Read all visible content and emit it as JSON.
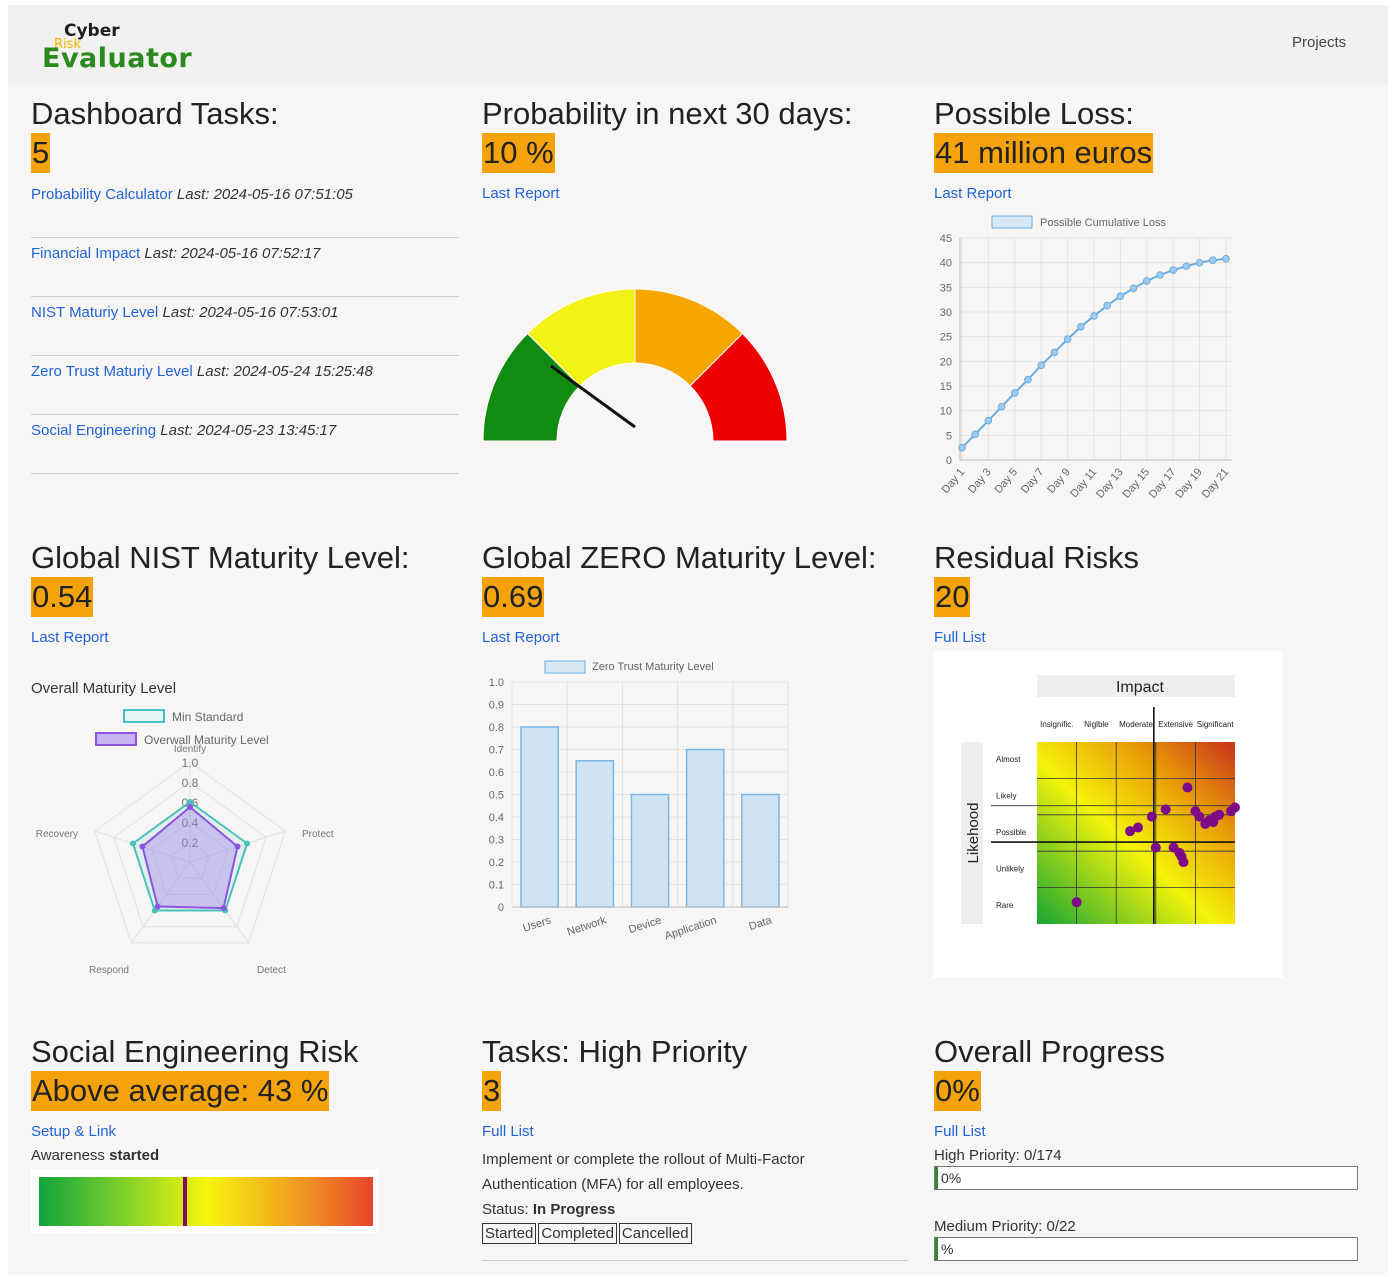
{
  "header": {
    "logo": {
      "line1": "Cyber",
      "line2": "Risk",
      "line3": "Evaluator"
    },
    "nav_projects": "Projects"
  },
  "dashboard_tasks": {
    "title": "Dashboard Tasks:",
    "count": "5",
    "tasks": [
      {
        "link": "Probability Calculator",
        "last": "Last: 2024-05-16 07:51:05"
      },
      {
        "link": "Financial Impact",
        "last": "Last: 2024-05-16 07:52:17"
      },
      {
        "link": "NIST Maturiy Level",
        "last": "Last: 2024-05-16 07:53:01"
      },
      {
        "link": "Zero Trust Maturiy Level",
        "last": "Last: 2024-05-24 15:25:48"
      },
      {
        "link": "Social Engineering",
        "last": "Last: 2024-05-23 13:45:17"
      }
    ]
  },
  "probability": {
    "title": "Probability in next 30 days:",
    "value": "10 %",
    "link": "Last Report",
    "gauge_fraction": 0.1,
    "gauge_colors": [
      "#118c11",
      "#f2f214",
      "#f7a600",
      "#ef0000"
    ]
  },
  "possible_loss": {
    "title": "Possible Loss:",
    "value": "41 million euros",
    "link": "Last Report"
  },
  "nist": {
    "title": "Global NIST Maturity Level:",
    "value": "0.54",
    "link": "Last Report"
  },
  "zero": {
    "title": "Global ZERO Maturity Level:",
    "value": "0.69",
    "link": "Last Report"
  },
  "residual": {
    "title": "Residual Risks",
    "value": "20",
    "link": "Full List",
    "matrix": {
      "impact_label": "Impact",
      "likelihood_label": "Likehood",
      "impact_levels": [
        "Insignific.",
        "Niglble",
        "Moderate",
        "Extensive",
        "Significant"
      ],
      "likelihood_levels": [
        "Almost",
        "Likely",
        "Possible",
        "Unlikely",
        "Rare"
      ],
      "dot_color": "#7d0a86"
    }
  },
  "social": {
    "title": "Social Engineering Risk",
    "value": "Above average: 43 %",
    "link": "Setup & Link",
    "awareness_label": "Awareness",
    "awareness_status": "started",
    "marker_fraction": 0.43
  },
  "tasks_high": {
    "title": "Tasks: High Priority",
    "count": "3",
    "link": "Full List",
    "task_text": "Implement or complete the rollout of Multi-Factor Authentication (MFA) for all employees.",
    "status_label": "Status:",
    "status_value": "In Progress",
    "buttons": [
      "Started",
      "Completed",
      "Cancelled"
    ]
  },
  "overall_progress": {
    "title": "Overall Progress",
    "value": "0%",
    "link": "Full List",
    "high_label": "High Priority: 0/174",
    "high_bar_text": "0%",
    "high_fraction": 0,
    "medium_label": "Medium Priority: 0/22",
    "medium_bar_text": "%",
    "medium_fraction": 0
  },
  "chart_data": [
    {
      "type": "line",
      "legend": "Possible Cumulative Loss",
      "x": [
        "Day 1",
        "Day 2",
        "Day 3",
        "Day 4",
        "Day 5",
        "Day 6",
        "Day 7",
        "Day 8",
        "Day 9",
        "Day 10",
        "Day 11",
        "Day 12",
        "Day 13",
        "Day 14",
        "Day 15",
        "Day 16",
        "Day 17",
        "Day 18",
        "Day 19",
        "Day 20",
        "Day 21"
      ],
      "x_tick_labels": [
        "Day 1",
        "Day 3",
        "Day 5",
        "Day 7",
        "Day 9",
        "Day 11",
        "Day 13",
        "Day 15",
        "Day 17",
        "Day 19",
        "Day 21"
      ],
      "values": [
        2.5,
        5.2,
        8.0,
        10.8,
        13.6,
        16.3,
        19.2,
        21.8,
        24.5,
        27.0,
        29.2,
        31.3,
        33.2,
        34.8,
        36.3,
        37.5,
        38.5,
        39.3,
        40.0,
        40.5,
        40.8
      ],
      "ylim": [
        0,
        45
      ],
      "yticks": [
        0,
        5,
        10,
        15,
        20,
        25,
        30,
        35,
        40,
        45
      ],
      "color": "#6aaee0",
      "grid": true,
      "legend_position": "top"
    },
    {
      "type": "radar",
      "title": "Overall Maturity Level",
      "axes": [
        "Identify",
        "Protect",
        "Detect",
        "Respond",
        "Recovery"
      ],
      "rlim": [
        0,
        1.0
      ],
      "rticks": [
        "0.2",
        "0.4",
        "0.6",
        "0.8",
        "1.0"
      ],
      "series": [
        {
          "name": "Min Standard",
          "values": [
            0.6,
            0.6,
            0.6,
            0.6,
            0.6
          ],
          "color": "#49c1bd"
        },
        {
          "name": "Overwall Maturity Level",
          "values": [
            0.55,
            0.5,
            0.57,
            0.55,
            0.5
          ],
          "color": "#8a55e0"
        }
      ],
      "legend_position": "top"
    },
    {
      "type": "bar",
      "legend": "Zero Trust Maturity Level",
      "categories": [
        "Users",
        "Network",
        "Device",
        "Application",
        "Data"
      ],
      "values": [
        0.8,
        0.65,
        0.5,
        0.7,
        0.5
      ],
      "ylim": [
        0,
        1.0
      ],
      "yticks": [
        "0",
        "0.1",
        "0.2",
        "0.3",
        "0.4",
        "0.5",
        "0.6",
        "0.7",
        "0.8",
        "0.9",
        "1.0"
      ],
      "color": "#cfe3f3",
      "stroke": "#7bb6e4",
      "grid": true,
      "legend_position": "top"
    },
    {
      "type": "scatter",
      "title": "Impact",
      "ylabel": "Likehood",
      "x_categories": [
        "Insignific.",
        "Niglble",
        "Moderate",
        "Extensive",
        "Significant"
      ],
      "y_categories": [
        "Rare",
        "Unlikely",
        "Possible",
        "Likely",
        "Almost"
      ],
      "points": [
        {
          "x": 1.5,
          "y": 1.1
        },
        {
          "x": 2.85,
          "y": 3.05
        },
        {
          "x": 3.05,
          "y": 3.15
        },
        {
          "x": 3.4,
          "y": 3.45
        },
        {
          "x": 3.75,
          "y": 3.65
        },
        {
          "x": 3.5,
          "y": 2.6
        },
        {
          "x": 4.3,
          "y": 4.25
        },
        {
          "x": 3.95,
          "y": 2.6
        },
        {
          "x": 4.1,
          "y": 2.45
        },
        {
          "x": 4.15,
          "y": 2.35
        },
        {
          "x": 4.2,
          "y": 2.2
        },
        {
          "x": 4.5,
          "y": 3.6
        },
        {
          "x": 4.6,
          "y": 3.45
        },
        {
          "x": 4.75,
          "y": 3.25
        },
        {
          "x": 4.85,
          "y": 3.35
        },
        {
          "x": 4.95,
          "y": 3.3
        },
        {
          "x": 5.0,
          "y": 3.45
        },
        {
          "x": 5.1,
          "y": 3.5
        },
        {
          "x": 5.4,
          "y": 3.6
        },
        {
          "x": 5.5,
          "y": 3.7
        }
      ]
    }
  ]
}
